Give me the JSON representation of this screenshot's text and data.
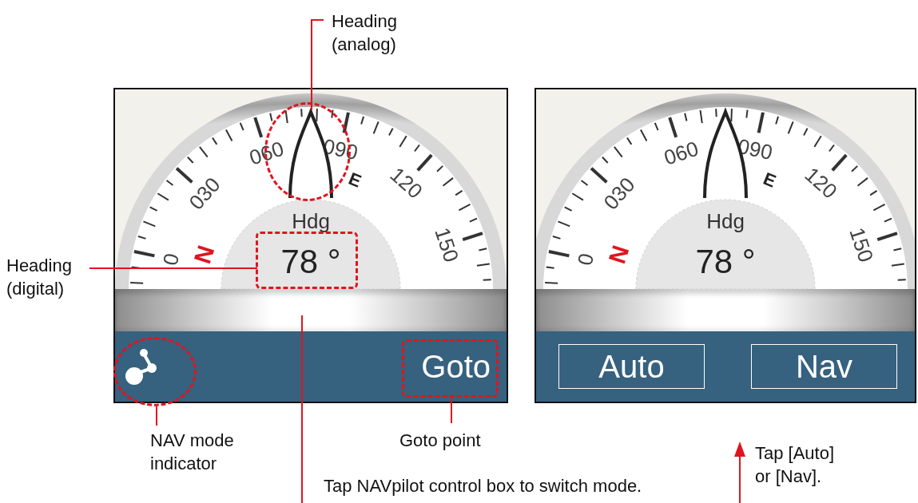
{
  "panels": [
    {
      "heading_label": "Hdg",
      "heading_value": "78 °",
      "scale_labels": [
        "0",
        "030",
        "060",
        "090",
        "120",
        "150"
      ],
      "north": "N",
      "east": "E",
      "bottom_items": [
        {
          "kind": "nav-icon"
        },
        {
          "kind": "text-button",
          "label": "Goto"
        }
      ]
    },
    {
      "heading_label": "Hdg",
      "heading_value": "78 °",
      "scale_labels": [
        "0",
        "030",
        "060",
        "090",
        "120",
        "150"
      ],
      "north": "N",
      "east": "E",
      "bottom_items": [
        {
          "kind": "boxed-button",
          "label": "Auto"
        },
        {
          "kind": "boxed-button",
          "label": "Nav"
        }
      ]
    }
  ],
  "callouts": [
    {
      "kind": "heading-analog",
      "text": "Heading (analog)"
    },
    {
      "kind": "heading-digital",
      "text": "Heading (digital)"
    },
    {
      "kind": "nav-mode",
      "text": "NAV mode indicator"
    },
    {
      "kind": "goto",
      "text": "Goto point"
    },
    {
      "kind": "tap-box",
      "text": "Tap NAVpilot control box to switch mode."
    },
    {
      "kind": "tap-buttons",
      "text": "Tap [Auto] or [Nav]."
    }
  ]
}
